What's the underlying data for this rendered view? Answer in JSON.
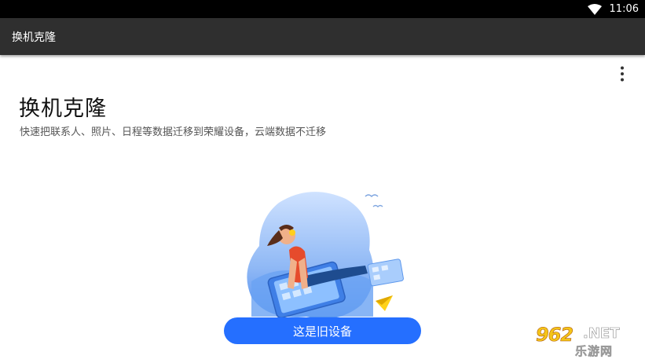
{
  "status_bar": {
    "time": "11:06",
    "wifi_icon": "wifi-icon"
  },
  "app_bar": {
    "title": "换机克隆"
  },
  "overflow_menu": {
    "icon": "more-vertical-icon"
  },
  "main": {
    "title": "换机克隆",
    "subtitle": "快速把联系人、照片、日程等数据迁移到荣耀设备，云端数据不迁移",
    "illustration_icon": "phone-transfer-illustration",
    "primary_button_label": "这是旧设备"
  },
  "watermark": {
    "number": "962",
    "suffix": ".NET",
    "text": "乐游网"
  },
  "colors": {
    "accent": "#256FFF",
    "app_bar": "#2F2F2F",
    "status_bar": "#000000"
  }
}
